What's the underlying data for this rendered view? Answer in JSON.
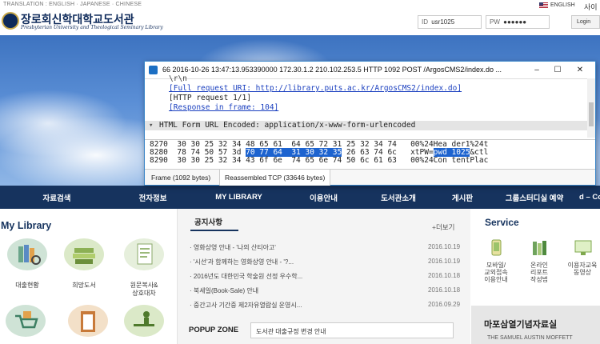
{
  "header": {
    "translation": "TRANSLATION : ENGLISH · JAPANESE · CHINESE",
    "logo_korean": "장로회신학대학교도서관",
    "logo_english": "Presbyterian University and Theological Seminary Library",
    "language": "ENGLISH",
    "site_link": "사이",
    "id_label": "ID",
    "id_value": "usr1025",
    "pw_label": "PW",
    "pw_value": "●●●●●●",
    "login_label": "Login"
  },
  "nav": {
    "items": [
      "자료검색",
      "전자정보",
      "MY LIBRARY",
      "이용안내",
      "도서관소개",
      "게시판",
      "그룹스터디실 예약",
      "d – Collection"
    ]
  },
  "my_library": {
    "title": "My Library",
    "items": [
      {
        "label": "대출현황",
        "icon": "books-search-icon"
      },
      {
        "label": "희망도서",
        "icon": "book-stack-icon"
      },
      {
        "label": "원문복사&\n상호대차",
        "icon": "document-icon"
      }
    ]
  },
  "notice": {
    "title": "공지사항",
    "more": "+더보기",
    "rows": [
      {
        "title": "· 영화상영 안내 - '나의 산티아고'",
        "date": "2016.10.19"
      },
      {
        "title": "· '시선'과 함께하는 영화상영 안내 - '?...",
        "date": "2016.10.19"
      },
      {
        "title": "· 2016년도 대한민국 학술원 선정 우수학...",
        "date": "2016.10.18"
      },
      {
        "title": "· 북세일(Book-Sale) 안내",
        "date": "2016.10.18"
      },
      {
        "title": "· 중간고사 기간중 제2자유열람실 운영시...",
        "date": "2016.09.29"
      }
    ],
    "popup_label": "POPUP ZONE",
    "popup_value": "도서관 대출규정 변경 안내"
  },
  "service": {
    "title": "Service",
    "items": [
      {
        "label": "모바일/\n교외접속\n이용안내",
        "icon": "mobile-guide-icon"
      },
      {
        "label": "온라인\n리포트\n작성법",
        "icon": "books-icon"
      },
      {
        "label": "이용자교육\n동영상",
        "icon": "monitor-icon"
      }
    ],
    "memorial_title": "마포삼열기념자료실",
    "memorial_sub": "THE SAMUEL AUSTIN MOFFETT"
  },
  "wireshark": {
    "title": "66 2016-10-26 13:47:13.953390000 172.30.1.2 210.102.253.5 HTTP 1092 POST /ArgosCMS2/index.do ...",
    "lines": {
      "top": "\\r\\n",
      "full_uri": "[Full request URI: http://library.puts.ac.kr/ArgosCMS2/index.do]",
      "http_request": "[HTTP request 1/1]",
      "response": "[Response in frame: 104]",
      "form": "HTML Form URL Encoded: application/x-www-form-urlencoded"
    },
    "hex": [
      {
        "offset": "8270",
        "bytes_a": "30 30 25 32 34 48 65 61  64 65 72 31 25 32 34 74",
        "bytes_sel": "",
        "bytes_b": "",
        "ascii_a": "00%24Hea der1%24t",
        "ascii_sel": "",
        "ascii_b": ""
      },
      {
        "offset": "8280",
        "bytes_a": "78 74 50 57 3d ",
        "bytes_sel": "70 77 64  31 30 32 35",
        "bytes_b": " 26 63 74 6c",
        "ascii_a": "xtPW=",
        "ascii_sel": "pwd 1025",
        "ascii_b": "&ctl"
      },
      {
        "offset": "8290",
        "bytes_a": "30 30 25 32 34 43 6f 6e  74 65 6e 74 50 6c 61 63",
        "bytes_sel": "",
        "bytes_b": "",
        "ascii_a": "00%24Con tentPlac",
        "ascii_sel": "",
        "ascii_b": ""
      }
    ],
    "tab_frame": "Frame (1092 bytes)",
    "tab_reassembled": "Reassembled TCP (33646 bytes)"
  }
}
